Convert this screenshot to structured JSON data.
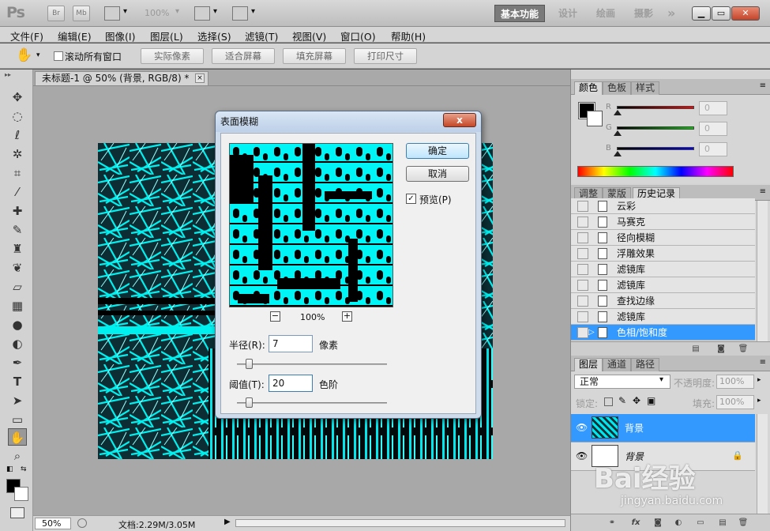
{
  "app": {
    "logo": "Ps",
    "bridge_buttons": [
      "Br",
      "Mb"
    ],
    "zoom_display": "100%",
    "workspaces": [
      {
        "label": "基本功能",
        "active": true
      },
      {
        "label": "设计",
        "active": false
      },
      {
        "label": "绘画",
        "active": false
      },
      {
        "label": "摄影",
        "active": false
      }
    ],
    "more": "»"
  },
  "menu": [
    "文件(F)",
    "编辑(E)",
    "图像(I)",
    "图层(L)",
    "选择(S)",
    "滤镜(T)",
    "视图(V)",
    "窗口(O)",
    "帮助(H)"
  ],
  "options": {
    "scroll_all_label": "滚动所有窗口",
    "buttons": [
      "实际像素",
      "适合屏幕",
      "填充屏幕",
      "打印尺寸"
    ]
  },
  "document": {
    "tab_title": "未标题-1 @ 50% (背景, RGB/8) *",
    "close": "×",
    "status_zoom": "50%",
    "status_doc": "文档:2.29M/3.05M"
  },
  "dialog": {
    "title": "表面模糊",
    "close": "x",
    "ok": "确定",
    "cancel": "取消",
    "preview_label": "预览(P)",
    "preview_checked": true,
    "zoom_percent": "100%",
    "zoom_minus": "−",
    "zoom_plus": "+",
    "radius_label": "半径(R):",
    "radius_value": "7",
    "radius_unit": "像素",
    "radius_level": 0.08,
    "threshold_label": "阈值(T):",
    "threshold_value": "20",
    "threshold_unit": "色阶",
    "threshold_level": 0.08
  },
  "color_panel": {
    "tabs": [
      {
        "label": "颜色",
        "active": true
      },
      {
        "label": "色板",
        "active": false
      },
      {
        "label": "样式",
        "active": false
      }
    ],
    "channels": [
      {
        "name": "R",
        "value": "0",
        "color": "#cc0000"
      },
      {
        "name": "G",
        "value": "0",
        "color": "#00aa00"
      },
      {
        "name": "B",
        "value": "0",
        "color": "#0000cc"
      }
    ],
    "foreground": "#000000",
    "background": "#ffffff"
  },
  "history_panel": {
    "tabs": [
      {
        "label": "调整",
        "active": false
      },
      {
        "label": "蒙版",
        "active": false
      },
      {
        "label": "历史记录",
        "active": true
      }
    ],
    "items": [
      {
        "label": "云彩",
        "selected": false
      },
      {
        "label": "马赛克",
        "selected": false
      },
      {
        "label": "径向模糊",
        "selected": false
      },
      {
        "label": "浮雕效果",
        "selected": false
      },
      {
        "label": "滤镜库",
        "selected": false
      },
      {
        "label": "滤镜库",
        "selected": false
      },
      {
        "label": "查找边缘",
        "selected": false
      },
      {
        "label": "滤镜库",
        "selected": false
      },
      {
        "label": "色相/饱和度",
        "selected": true
      }
    ]
  },
  "layers_panel": {
    "tabs": [
      {
        "label": "图层",
        "active": true
      },
      {
        "label": "通道",
        "active": false
      },
      {
        "label": "路径",
        "active": false
      }
    ],
    "blend_mode": "正常",
    "opacity_label": "不透明度:",
    "opacity_value": "100%",
    "lock_label": "锁定:",
    "fill_label": "填充:",
    "fill_value": "100%",
    "layers": [
      {
        "name": "背景",
        "selected": true,
        "italic": false
      },
      {
        "name": "背景",
        "selected": false,
        "italic": true
      }
    ],
    "footer_fx": "fx"
  },
  "watermark": {
    "brand": "Bai经验",
    "url": "jingyan.baidu.com"
  },
  "colors": {
    "accent_selection": "#3399ff",
    "image_cyan": "#00f0f0"
  }
}
